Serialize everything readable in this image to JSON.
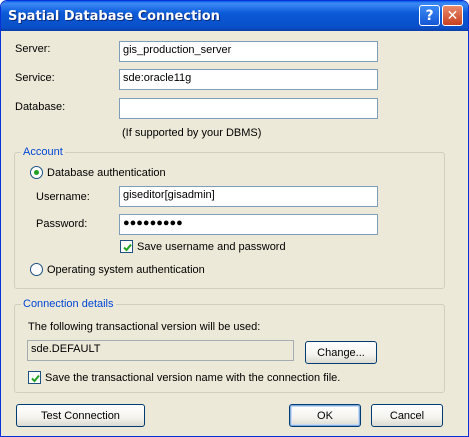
{
  "window": {
    "title": "Spatial Database Connection",
    "help_glyph": "?",
    "close_glyph": "✕"
  },
  "server": {
    "label": "Server:",
    "value": "gis_production_server"
  },
  "service": {
    "label": "Service:",
    "value": "sde:oracle11g"
  },
  "database": {
    "label": "Database:",
    "value": "",
    "hint": "(If supported by your DBMS)"
  },
  "account": {
    "legend": "Account",
    "db_auth_label": "Database authentication",
    "db_auth_selected": true,
    "username_label": "Username:",
    "username_value": "giseditor[gisadmin]",
    "password_label": "Password:",
    "password_mask": "●●●●●●●●●",
    "save_credentials_label": "Save username and password",
    "save_credentials_checked": true,
    "os_auth_label": "Operating system authentication",
    "os_auth_selected": false
  },
  "connection_details": {
    "legend": "Connection details",
    "description": "The following transactional version will be used:",
    "version_value": "sde.DEFAULT",
    "change_button": "Change...",
    "save_version_label": "Save the transactional version name with the connection file.",
    "save_version_checked": true
  },
  "buttons": {
    "test_connection": "Test Connection",
    "ok": "OK",
    "cancel": "Cancel"
  },
  "colors": {
    "title_bar": "#0a4fc9",
    "group_legend": "#0046d5",
    "dialog_background": "#ece9d8"
  },
  "icons": {
    "help": "help-icon",
    "close": "close-icon",
    "checkmark": "checkmark-icon"
  }
}
